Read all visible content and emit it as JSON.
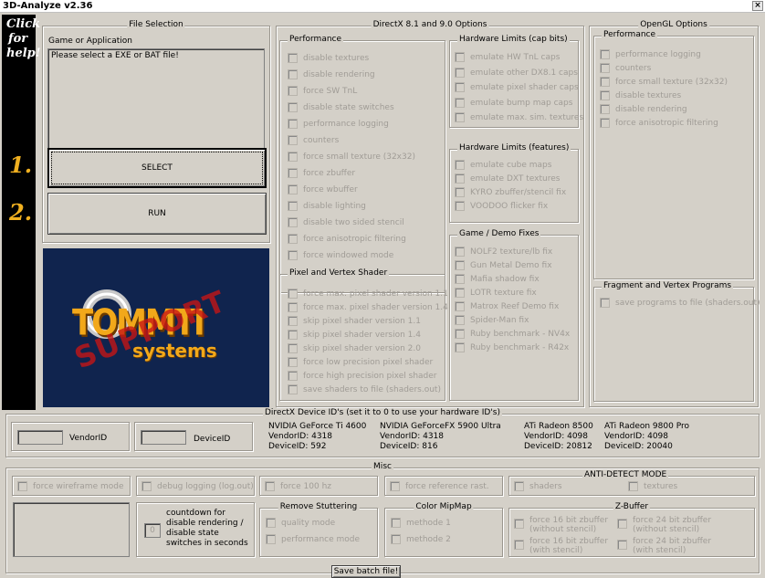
{
  "window": {
    "title": "3D-Analyze v2.36",
    "close_glyph": "×"
  },
  "sidebar": {
    "help_text": [
      "Click",
      "for",
      "help!"
    ],
    "step1": "1.",
    "step2": "2."
  },
  "file_selection": {
    "title": "File Selection",
    "label": "Game or Application",
    "message": "Please select a EXE or BAT file!",
    "select_label": "SELECT",
    "run_label": "RUN"
  },
  "logo": {
    "brand": "TOMMTI",
    "sub": "systems",
    "stamp": "SUPPORT"
  },
  "directx": {
    "title": "DirectX 8.1 and 9.0 Options",
    "performance": {
      "title": "Performance",
      "items": [
        "disable textures",
        "disable rendering",
        "force SW TnL",
        "disable state switches",
        "performance logging",
        "counters",
        "force small texture (32x32)",
        "force zbuffer",
        "force wbuffer",
        "disable lighting",
        "disable two sided stencil",
        "force anisotropic filtering",
        "force windowed mode"
      ]
    },
    "pixel_vertex": {
      "title": "Pixel and Vertex Shader",
      "items": [
        "force max. pixel shader version 1.1",
        "force max. pixel shader version 1.4",
        "skip pixel shader version 1.1",
        "skip pixel shader version 1.4",
        "skip pixel shader version 2.0",
        "force low precision pixel shader",
        "force high precision pixel shader",
        "save shaders to file (shaders.out)"
      ]
    },
    "hw_caps": {
      "title": "Hardware Limits (cap bits)",
      "items": [
        "emulate HW TnL caps",
        "emulate other DX8.1 caps",
        "emulate pixel shader caps",
        "emulate bump map caps",
        "emulate max. sim. textures"
      ]
    },
    "hw_features": {
      "title": "Hardware Limits (features)",
      "items": [
        "emulate cube maps",
        "emulate DXT textures",
        "KYRO zbuffer/stencil fix",
        "VOODOO flicker fix"
      ]
    },
    "game_fixes": {
      "title": "Game / Demo Fixes",
      "items": [
        "NOLF2 texture/lb fix",
        "Gun Metal Demo fix",
        "Mafia shadow fix",
        "LOTR texture fix",
        "Matrox Reef Demo fix",
        "Spider-Man fix",
        "Ruby benchmark - NV4x",
        "Ruby benchmark - R42x"
      ]
    }
  },
  "opengl": {
    "title": "OpenGL Options",
    "performance": {
      "title": "Performance",
      "items": [
        "performance logging",
        "counters",
        "force small texture (32x32)",
        "disable textures",
        "disable rendering",
        "force anisotropic filtering"
      ]
    },
    "fragment": {
      "title": "Fragment and Vertex Programs",
      "items": [
        "save programs to file (shaders.out)"
      ]
    }
  },
  "device_ids": {
    "title": "DirectX Device ID's (set it to 0 to use your hardware ID's)",
    "vendor_label": "VendorID",
    "device_label": "DeviceID",
    "gpus": [
      {
        "name": "NVIDIA GeForce Ti 4600",
        "vendor": "VendorID: 4318",
        "device": "DeviceID: 592"
      },
      {
        "name": "NVIDIA GeForceFX 5900 Ultra",
        "vendor": "VendorID: 4318",
        "device": "DeviceID: 816"
      },
      {
        "name": "ATi Radeon 8500",
        "vendor": "VendorID: 4098",
        "device": "DeviceID: 20812"
      },
      {
        "name": "ATi Radeon 9800 Pro",
        "vendor": "VendorID: 4098",
        "device": "DeviceID: 20040"
      }
    ]
  },
  "misc": {
    "title": "Misc",
    "wireframe": "force wireframe mode",
    "debug": "debug logging (log.out)",
    "hz": "force 100 hz",
    "refrast": "force reference rast.",
    "countdown_value": "0",
    "countdown_label": "countdown for disable rendering / disable state switches in seconds",
    "stutter": {
      "title": "Remove Stuttering",
      "items": [
        "quality mode",
        "performance mode"
      ]
    },
    "mipmap": {
      "title": "Color MipMap",
      "items": [
        "methode 1",
        "methode 2"
      ]
    },
    "antidetect": {
      "title": "ANTI-DETECT MODE",
      "items": [
        "shaders",
        "textures"
      ]
    },
    "zbuffer": {
      "title": "Z-Buffer",
      "items": [
        "force 16 bit zbuffer (without stencil)",
        "force 24 bit zbuffer (without stencil)",
        "force 16 bit zbuffer (with stencil)",
        "force 24 bit zbuffer (with stencil)"
      ]
    },
    "save_batch": "Save batch file!"
  }
}
